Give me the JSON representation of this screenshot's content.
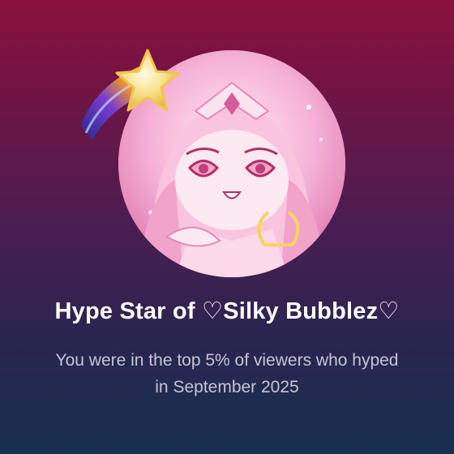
{
  "badge": {
    "icon": "shooting-star-icon",
    "title": "Hype Star of ♡Silky Bubblez♡",
    "description": "You were in the top 5% of viewers who hyped in September 2025"
  },
  "avatar": {
    "icon": "avatar"
  },
  "colors": {
    "background_top": "#8a0f3c",
    "background_bottom": "#17304f",
    "title_text": "#ffffff",
    "description_text": "#c9c3d6",
    "star_gold": "#f7d35a"
  }
}
